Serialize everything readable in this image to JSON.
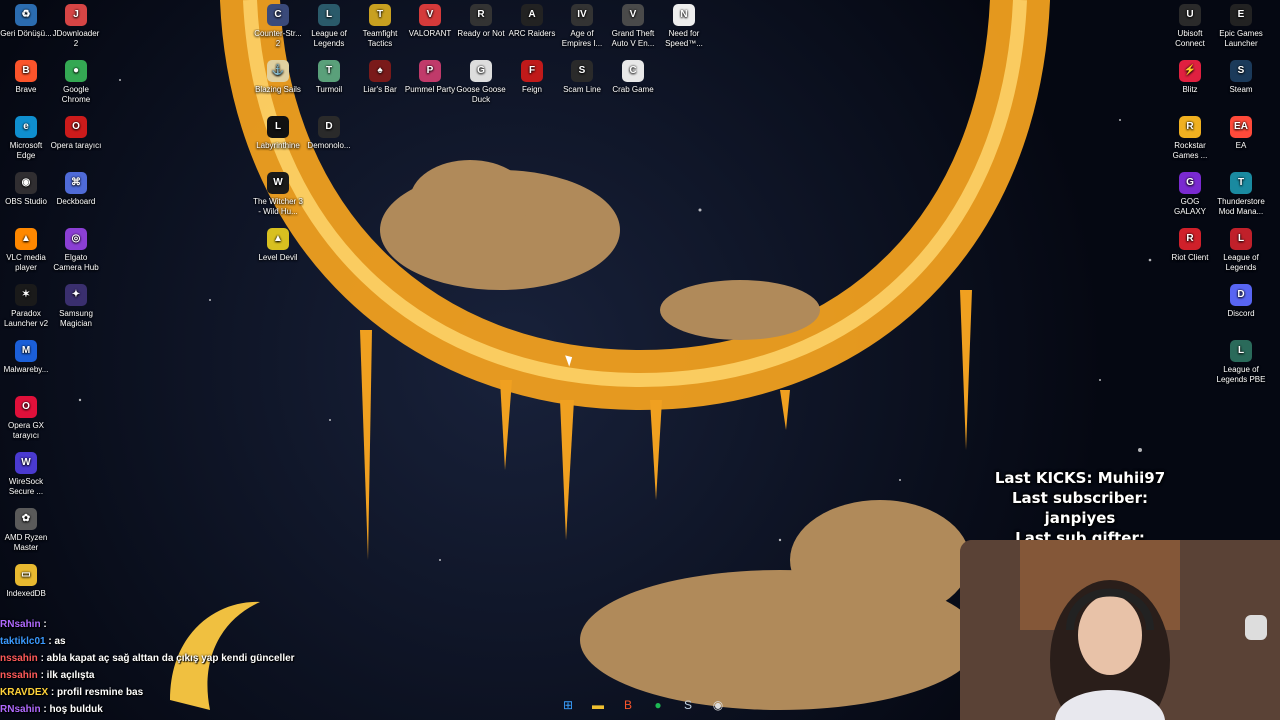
{
  "desktop_icons_left": [
    {
      "label": "Geri Dönüşü...",
      "icon": "recycle-bin-icon",
      "color": "#2b6cb0",
      "glyph": "♻"
    },
    {
      "label": "JDownloader 2",
      "icon": "jdownloader-icon",
      "color": "#d64545",
      "glyph": "J"
    },
    {
      "label": "Brave",
      "icon": "brave-icon",
      "color": "#fb542b",
      "glyph": "B"
    },
    {
      "label": "Google Chrome",
      "icon": "chrome-icon",
      "color": "#34a853",
      "glyph": "●"
    },
    {
      "label": "Microsoft Edge",
      "icon": "edge-icon",
      "color": "#0f8fcf",
      "glyph": "e"
    },
    {
      "label": "Opera tarayıcı",
      "icon": "opera-icon",
      "color": "#cc1b1b",
      "glyph": "O"
    },
    {
      "label": "OBS Studio",
      "icon": "obs-icon",
      "color": "#302e31",
      "glyph": "◉"
    },
    {
      "label": "Deckboard",
      "icon": "deckboard-icon",
      "color": "#4f6bd8",
      "glyph": "⌘"
    },
    {
      "label": "VLC media player",
      "icon": "vlc-icon",
      "color": "#ff8800",
      "glyph": "▲"
    },
    {
      "label": "Elgato Camera Hub",
      "icon": "elgato-icon",
      "color": "#8b3fd4",
      "glyph": "◎"
    },
    {
      "label": "Paradox Launcher v2",
      "icon": "paradox-icon",
      "color": "#1a1a1a",
      "glyph": "✶"
    },
    {
      "label": "Samsung Magician",
      "icon": "samsung-magician-icon",
      "color": "#3a2f6e",
      "glyph": "✦"
    },
    {
      "label": "Malwareby...",
      "icon": "malwarebytes-icon",
      "color": "#1b5fd8",
      "glyph": "M"
    },
    {
      "label": "Opera GX tarayıcı",
      "icon": "opera-gx-icon",
      "color": "#e0103a",
      "glyph": "O"
    },
    {
      "label": "WireSock Secure ...",
      "icon": "wiresock-icon",
      "color": "#4a3ad0",
      "glyph": "W"
    },
    {
      "label": "AMD Ryzen Master",
      "icon": "amd-ryzen-icon",
      "color": "#5a5a5a",
      "glyph": "✿"
    },
    {
      "label": "IndexedDB",
      "icon": "folder-icon",
      "color": "#e8b930",
      "glyph": "▭"
    }
  ],
  "desktop_icons_games": [
    {
      "label": "Counter-Str... 2",
      "icon": "counter-strike-icon",
      "color": "#3a4a7a",
      "glyph": "C"
    },
    {
      "label": "League of Legends",
      "icon": "league-of-legends-icon",
      "color": "#2a5a6a",
      "glyph": "L"
    },
    {
      "label": "Teamfight Tactics",
      "icon": "teamfight-tactics-icon",
      "color": "#c8a020",
      "glyph": "T"
    },
    {
      "label": "VALORANT",
      "icon": "valorant-icon",
      "color": "#d43a3a",
      "glyph": "V"
    },
    {
      "label": "Ready or Not",
      "icon": "ready-or-not-icon",
      "color": "#333",
      "glyph": "R"
    },
    {
      "label": "ARC Raiders",
      "icon": "arc-raiders-icon",
      "color": "#222",
      "glyph": "A"
    },
    {
      "label": "Age of Empires I...",
      "icon": "age-of-empires-icon",
      "color": "#333",
      "glyph": "IV"
    },
    {
      "label": "Grand Theft Auto V En...",
      "icon": "gta-v-icon",
      "color": "#4a4a4a",
      "glyph": "V"
    },
    {
      "label": "Need for Speed™...",
      "icon": "need-for-speed-icon",
      "color": "#eee",
      "glyph": "N"
    },
    {
      "label": "Blazing Sails",
      "icon": "blazing-sails-icon",
      "color": "#e0d0a0",
      "glyph": "⚓"
    },
    {
      "label": "Turmoil",
      "icon": "turmoil-icon",
      "color": "#5aa07a",
      "glyph": "T"
    },
    {
      "label": "Liar's Bar",
      "icon": "liars-bar-icon",
      "color": "#7a1a1a",
      "glyph": "♠"
    },
    {
      "label": "Pummel Party",
      "icon": "pummel-party-icon",
      "color": "#c03a6a",
      "glyph": "P"
    },
    {
      "label": "Goose Goose Duck",
      "icon": "goose-goose-duck-icon",
      "color": "#dddddd",
      "glyph": "G"
    },
    {
      "label": "Feign",
      "icon": "feign-icon",
      "color": "#c01a1a",
      "glyph": "F"
    },
    {
      "label": "Scam Line",
      "icon": "scam-line-icon",
      "color": "#2a2a2a",
      "glyph": "S"
    },
    {
      "label": "Crab Game",
      "icon": "crab-game-icon",
      "color": "#e8e8e8",
      "glyph": "C"
    },
    {
      "label": "Labyrinthine",
      "icon": "labyrinthine-icon",
      "color": "#111",
      "glyph": "L"
    },
    {
      "label": "Demonolo...",
      "icon": "demonologist-icon",
      "color": "#2a2a2a",
      "glyph": "D"
    },
    {
      "label": "The Witcher 3 - Wild Hu...",
      "icon": "witcher-3-icon",
      "color": "#1a1a1a",
      "glyph": "W"
    },
    {
      "label": "Level Devil",
      "icon": "level-devil-icon",
      "color": "#d8c020",
      "glyph": "▲"
    }
  ],
  "desktop_icons_right": [
    {
      "label": "Ubisoft Connect",
      "icon": "ubisoft-connect-icon",
      "color": "#2a2a2a",
      "glyph": "U"
    },
    {
      "label": "Epic Games Launcher",
      "icon": "epic-games-icon",
      "color": "#222",
      "glyph": "E"
    },
    {
      "label": "Blitz",
      "icon": "blitz-icon",
      "color": "#e02040",
      "glyph": "⚡"
    },
    {
      "label": "Steam",
      "icon": "steam-icon",
      "color": "#1b3a5a",
      "glyph": "S"
    },
    {
      "label": "Rockstar Games ...",
      "icon": "rockstar-icon",
      "color": "#f0b020",
      "glyph": "R"
    },
    {
      "label": "EA",
      "icon": "ea-icon",
      "color": "#ff4a3a",
      "glyph": "EA"
    },
    {
      "label": "GOG GALAXY",
      "icon": "gog-galaxy-icon",
      "color": "#7a2ad0",
      "glyph": "G"
    },
    {
      "label": "Thunderstore Mod Mana...",
      "icon": "thunderstore-icon",
      "color": "#1a8aa0",
      "glyph": "T"
    },
    {
      "label": "Riot Client",
      "icon": "riot-client-icon",
      "color": "#d0202a",
      "glyph": "R"
    },
    {
      "label": "League of Legends",
      "icon": "league-of-legends-icon",
      "color": "#c0202a",
      "glyph": "L"
    },
    {
      "label": "Discord",
      "icon": "discord-icon",
      "color": "#5865f2",
      "glyph": "D"
    },
    {
      "label": "League of Legends PBE",
      "icon": "league-of-legends-pbe-icon",
      "color": "#2a6a5a",
      "glyph": "L"
    }
  ],
  "stream_overlay": {
    "last_kicks": "Last KICKS: Muhii97",
    "last_subscriber": "Last subscriber: janpiyes",
    "last_sub_gifter": "Last sub gifter: KRAVDEX"
  },
  "chat": [
    {
      "user": "RNsahin",
      "text": " : ",
      "user_color": "#b06aff"
    },
    {
      "user": "taktiklc01",
      "text": " : as",
      "user_color": "#3a9aff"
    },
    {
      "user": "nssahin",
      "text": " : abla kapat aç sağ alttan da çıkış yap kendi günceller",
      "user_color": "#ff5a5a"
    },
    {
      "user": "nssahin",
      "text": " : ilk açılışta",
      "user_color": "#ff5a5a"
    },
    {
      "user": "KRAVDEX",
      "text": " : profil resmine bas",
      "user_color": "#ffd23a"
    },
    {
      "user": "RNsahin",
      "text": " : hoş bulduk",
      "user_color": "#b06aff"
    }
  ],
  "taskbar": [
    {
      "name": "start-button",
      "icon": "windows-icon",
      "glyph": "⊞",
      "color": "#3aa0ff"
    },
    {
      "name": "file-explorer-button",
      "icon": "folder-icon",
      "glyph": "▬",
      "color": "#f0c030"
    },
    {
      "name": "brave-taskbar-button",
      "icon": "brave-icon",
      "glyph": "B",
      "color": "#fb542b"
    },
    {
      "name": "spotify-taskbar-button",
      "icon": "spotify-icon",
      "glyph": "●",
      "color": "#1db954"
    },
    {
      "name": "steam-taskbar-button",
      "icon": "steam-icon",
      "glyph": "S",
      "color": "#c0d0e0"
    },
    {
      "name": "obs-taskbar-button",
      "icon": "obs-icon",
      "glyph": "◉",
      "color": "#dddddd"
    }
  ]
}
